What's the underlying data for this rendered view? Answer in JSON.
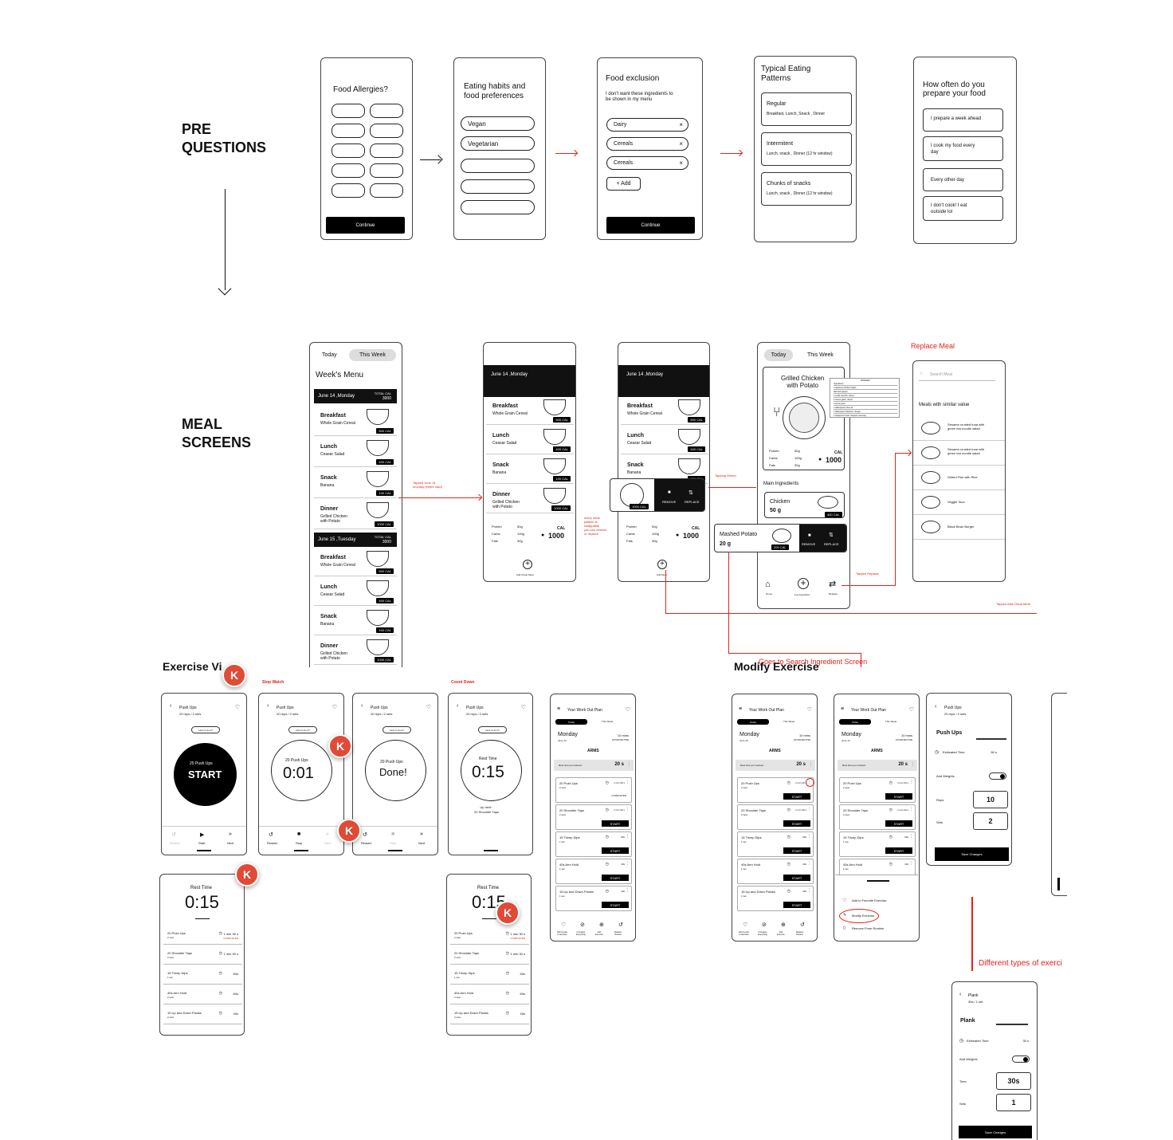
{
  "sections": {
    "pre_questions": "PRE\nQUESTIONS",
    "meal_screens": "MEAL\nSCREENS",
    "exercise": "Exercise Vi",
    "modify_exercise": "Modify Exercise"
  },
  "pre": {
    "s1": {
      "title": "Food Allergies?",
      "button": "Continue"
    },
    "s2": {
      "title": "Eating habits and\nfood preferences",
      "options": [
        "Vegan",
        "Vegetarian"
      ]
    },
    "s3": {
      "title": "Food exclusion",
      "subtitle": "I don't want these ingredients to\nbe shown in my menu",
      "chips": [
        "Dairy",
        "Cereals",
        "Cereals"
      ],
      "add": "+ Add",
      "button": "Continue"
    },
    "s4": {
      "title": "Typical Eating\nPatterns",
      "cards": [
        {
          "name": "Regular",
          "desc": "Breakfast, Lunch, Snack , Dinner"
        },
        {
          "name": "Intermitent",
          "desc": "Lunch, snack , Dinner (12 hr window)"
        },
        {
          "name": "Chunks of snacks",
          "desc": "Lunch, snack , Dinner (12 hr window)"
        }
      ]
    },
    "s5": {
      "title": "How often do you\nprepare your food",
      "options": [
        "I prepare a week ahead",
        "I cook my food every\nday",
        "Every other day",
        "I don't cook! I eat\noutside lol"
      ]
    }
  },
  "meal": {
    "tabs": {
      "today": "Today",
      "week": "This Week"
    },
    "weeks_menu": "Week's Menu",
    "day1": {
      "date": "June 14 ,Monday",
      "total_label": "TOTAL CAL",
      "total": "3000"
    },
    "day2": {
      "date": "June 15 ,Tuesday",
      "total_label": "TOTAL CAL",
      "total": "3000"
    },
    "day_header": "June 14 ,Monday",
    "items": [
      {
        "name": "Breakfast",
        "desc": "Whole Grain Cereal",
        "cal": "500 CAL"
      },
      {
        "name": "Lunch",
        "desc": "Ceasar Salad",
        "cal": "400 CAL"
      },
      {
        "name": "Snack",
        "desc": "Banana",
        "cal": "100 CAL"
      },
      {
        "name": "Dinner",
        "desc": "Grilled Chicken\nwith Potato",
        "cal": "1000 CAL"
      }
    ],
    "macros": {
      "protein_l": "Protein",
      "protein": "50g",
      "carbs_l": "Carbs",
      "carbs": "100g",
      "fats_l": "Fats",
      "fats": "30g",
      "cal_l": "CAL",
      "cal": "1000"
    },
    "add_cheat": "Add Cheat Meal",
    "add_meal": "Add Meal",
    "remove": "REMOVE",
    "replace": "REPLACE",
    "dish": {
      "title": "Grilled Chicken\nwith Potato",
      "main_ing": "Main Ingredients",
      "ing1": "Chicken",
      "ing1_w": "50 g",
      "ing1_cal": "400 CAL",
      "ing2": "Mashed Potato",
      "ing2_w": "20 g",
      "ing2_cal": "200 CAL"
    },
    "recipe_title": "DINNER",
    "recipe_lines": [
      "Ingredients",
      "4 deboned chicken thighs",
      "Salt and pepper",
      "1 small zucchini, sliced",
      "2 cloves garlic, sliced",
      "1 lemon juice",
      "1 tablespoons lime oil",
      "1 tablespoon balsamic vinegar",
      "1 teaspoons fresh chopped rosemary"
    ],
    "nav": {
      "home": "Home",
      "log": "Log Ingredient",
      "replace": "Replace"
    },
    "replace_meal": {
      "title": "Replace Meal",
      "search": "Search Meal",
      "similar": "Meals with similar value",
      "items": [
        "Sesame-crusted tuna with\ngreen tea noodle salad",
        "Sesame-crusted tuna with\ngreen tea noodle salad",
        "Grilled Fish with Rice",
        "Veggie Taco",
        "Black Bean Burger"
      ]
    },
    "annotations": {
      "tapped_june": "Tapped June 14\nmonday (entire card)",
      "every_meal": "every meal\npattern is\nswappable\nyou can remove\nor replace",
      "tapping_dinner": "Tapping Dinner",
      "tapped_replace": "Tapped Replace",
      "tapped_cheat": "Tapped Add Cheat Meal",
      "goto_search": "Goes to Search Ingredient Screen"
    }
  },
  "exercise": {
    "stop_watch": "Stop Watch",
    "count_down": "Count Down",
    "push_ups": "Push Ups",
    "reps": "20 reps / 2 sets",
    "how_to": "How to do it?",
    "start_sub": "20 Push Ups",
    "start": "START",
    "timer": "0:01",
    "done": "Done!",
    "rest": "Rest Time",
    "rest_val": "0:15",
    "up_next": "Up next :\n20 Shoulder Taps",
    "ctrl": {
      "restart": "Restart",
      "start": "Start",
      "stop": "Stop",
      "next": "Next"
    },
    "avatar": "K",
    "list": [
      {
        "name": "20 Push Ups",
        "sets": "2 sets",
        "time": "1 min 30 s",
        "status": "COMPLETED"
      },
      {
        "name": "20 Shoulder Taps",
        "sets": "2 sets",
        "time": "1 min 30 s"
      },
      {
        "name": "15 Tricep Dips",
        "sets": "1 set",
        "time": "50s"
      },
      {
        "name": "40s Arm Hold",
        "sets": "2 sets",
        "time": "60s"
      },
      {
        "name": "15 Up and Down Planks",
        "sets": "2 sets",
        "time": "40s"
      }
    ],
    "plan": {
      "title": "Your Work Out Plan",
      "tab1": "Today",
      "tab2": "This Week",
      "day": "Monday",
      "date": "June 13",
      "est": "10 mins",
      "est_l": "ESTIMATED TIME",
      "group": "ARMS",
      "rest_l": "Rest time per workout",
      "rest_v": "20 s",
      "start": "START",
      "completed": "COMPLETED",
      "items": [
        {
          "name": "20 Push Ups",
          "sets": "2 sets",
          "time": "1 min 30 s"
        },
        {
          "name": "20 Shoulder Taps",
          "sets": "2 sets",
          "time": "1 min 30 s"
        },
        {
          "name": "15 Tricep Dips",
          "sets": "1 set",
          "time": "60s"
        },
        {
          "name": "40s Arm Hold",
          "sets": "1 set",
          "time": "40s"
        },
        {
          "name": "15 Up and Down Planks",
          "sets": "1 set",
          "time": "40s"
        }
      ],
      "nav": [
        "Add muscle\nto favorites",
        "Complete\nEverything",
        "Add\nExercise",
        "Replace\nRoutine"
      ]
    },
    "menu": {
      "fav": "Add to Favorite Exercise",
      "modify": "Modify Exercise",
      "remove": "Remove From Routine"
    },
    "edit": {
      "name": "Push Ups",
      "sub": "20 reps / 2 sets",
      "est_l": "Estimated Time",
      "est": "60 s",
      "weights": "Add Weights",
      "reps_l": "Reps",
      "reps": "10",
      "sets_l": "Sets",
      "sets": "2",
      "save": "Save Changes"
    },
    "plank": {
      "name": "Plank",
      "sub": "30s / 1 set",
      "est_l": "Estimated Time",
      "est": "30 s",
      "weights": "Add Weights",
      "time_l": "Time",
      "time": "30s",
      "sets_l": "Sets",
      "sets": "1",
      "save": "Save Changes"
    },
    "diff_types": "Different types of exerci"
  }
}
